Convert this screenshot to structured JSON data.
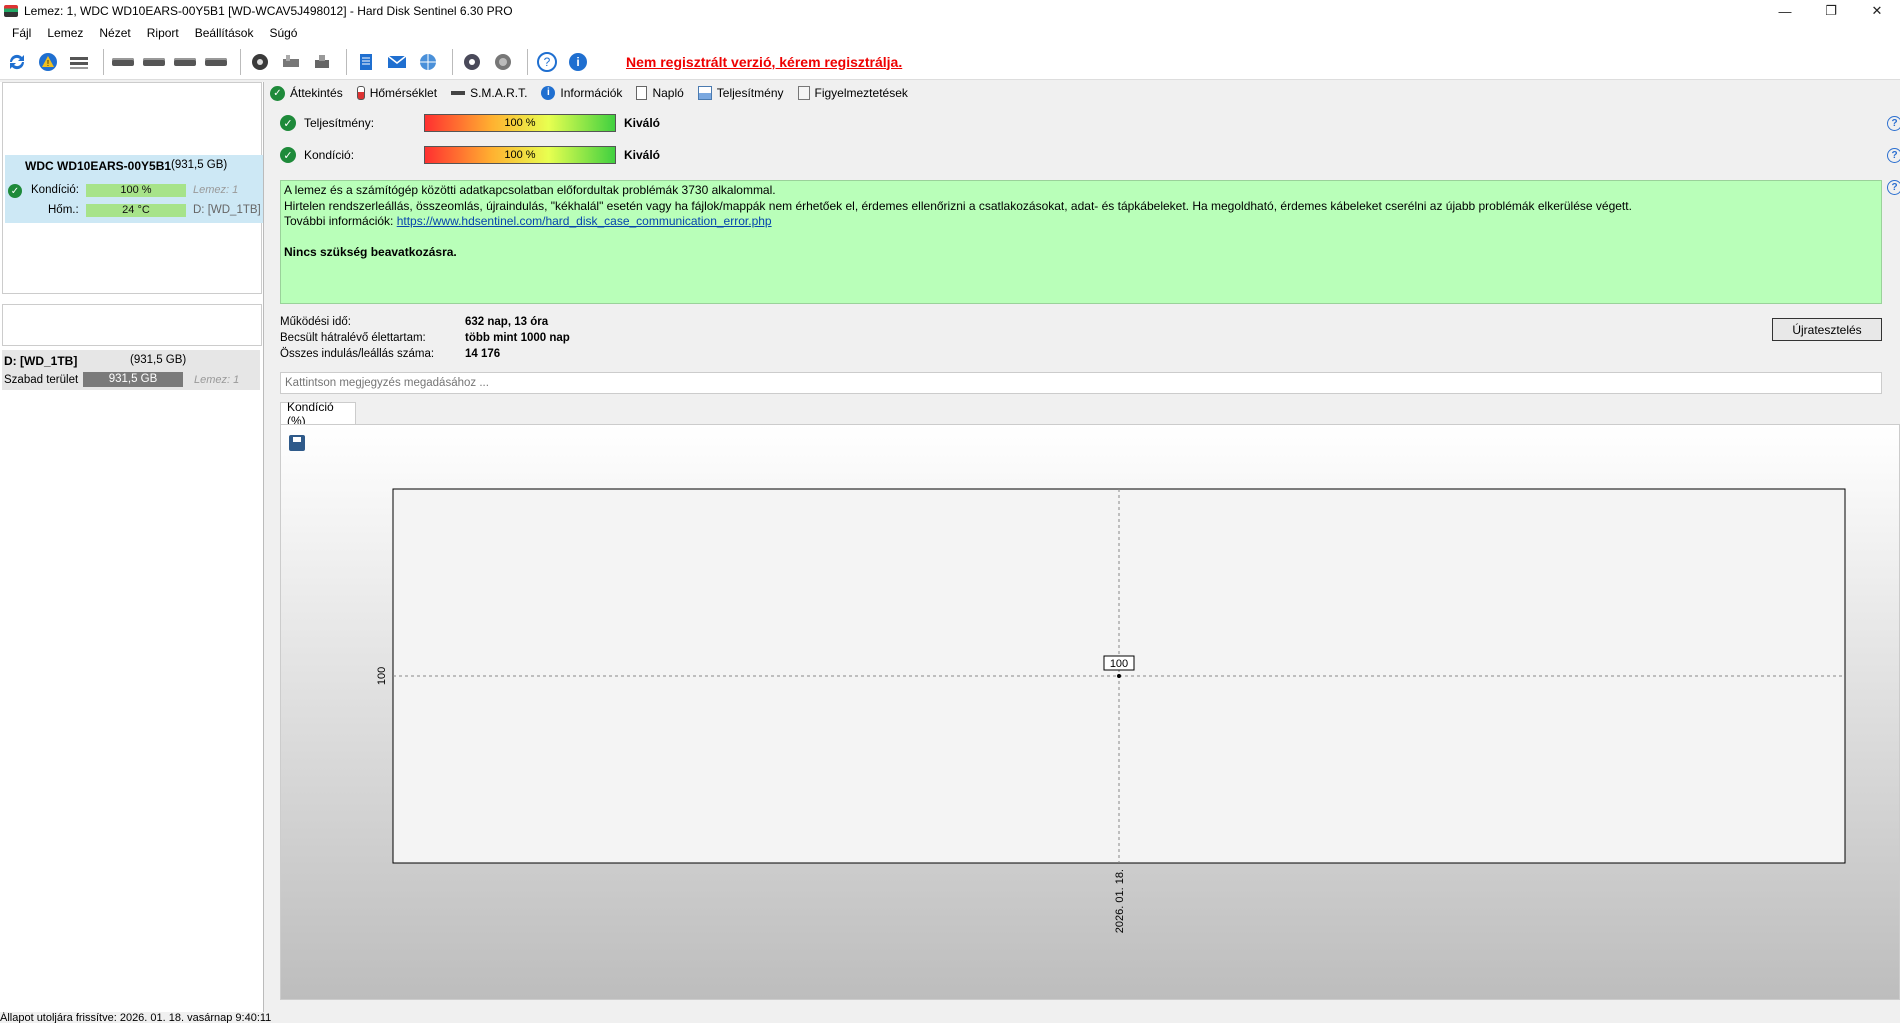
{
  "window": {
    "title": "Lemez: 1, WDC WD10EARS-00Y5B1 [WD-WCAV5J498012]  - Hard Disk Sentinel 6.30 PRO",
    "minimize": "—",
    "maximize": "❐",
    "close": "✕"
  },
  "menu": [
    "Fájl",
    "Lemez",
    "Nézet",
    "Riport",
    "Beállítások",
    "Súgó"
  ],
  "toolbar": {
    "registration_warning": "Nem regisztrált verzió, kérem regisztrálja."
  },
  "left": {
    "disk": {
      "name": "WDC WD10EARS-00Y5B1",
      "size": "(931,5 GB)",
      "condition_label": "Kondíció:",
      "condition_value": "100 %",
      "condition_percent": 100,
      "disk_ref": "Lemez: 1",
      "temp_label": "Hőm.:",
      "temp_value": "24 °C",
      "drive_ref": "D: [WD_1TB]"
    },
    "volume": {
      "name": "D: [WD_1TB]",
      "size": "(931,5 GB)",
      "free_label": "Szabad terület",
      "free_value": "931,5 GB",
      "disk_ref": "Lemez: 1"
    }
  },
  "tabs": [
    "Áttekintés",
    "Hőmérséklet",
    "S.M.A.R.T.",
    "Információk",
    "Napló",
    "Teljesítmény",
    "Figyelmeztetések"
  ],
  "overview": {
    "performance": {
      "label": "Teljesítmény:",
      "value": "100 %",
      "percent": 100,
      "rating": "Kiváló"
    },
    "condition": {
      "label": "Kondíció:",
      "value": "100 %",
      "percent": 100,
      "rating": "Kiváló"
    },
    "message": {
      "line1": "A lemez és a számítógép közötti adatkapcsolatban előfordultak problémák 3730 alkalommal.",
      "line2": "Hirtelen rendszerleállás, összeomlás, újraindulás, \"kékhalál\" esetén vagy ha fájlok/mappák nem érhetőek el, érdemes ellenőrizni a csatlakozásokat, adat- és tápkábeleket. Ha megoldható, érdemes kábeleket cserélni az újabb problémák elkerülése végett.",
      "line3_prefix": "További információk: ",
      "link": "https://www.hdsentinel.com/hard_disk_case_communication_error.php",
      "action": "Nincs szükség beavatkozásra."
    },
    "info": [
      {
        "label": "Működési idő:",
        "value": "632 nap, 13 óra"
      },
      {
        "label": "Becsült hátralévő élettartam:",
        "value": "több mint 1000 nap"
      },
      {
        "label": "Összes indulás/leállás száma:",
        "value": "14 176"
      }
    ],
    "retest_button": "Újratesztelés",
    "note_placeholder": "Kattintson megjegyzés megadásához ..."
  },
  "graph": {
    "tab_label": "Kondíció  (%)"
  },
  "chart_data": {
    "type": "line",
    "x": [
      "2026. 01. 18."
    ],
    "series": [
      {
        "values": [
          100
        ]
      }
    ],
    "ytick": "100",
    "xtick": "2026. 01. 18.",
    "point_label": "100"
  },
  "statusbar": {
    "text": "Állapot utoljára frissítve: 2026. 01. 18. vasárnap 9:40:11"
  }
}
